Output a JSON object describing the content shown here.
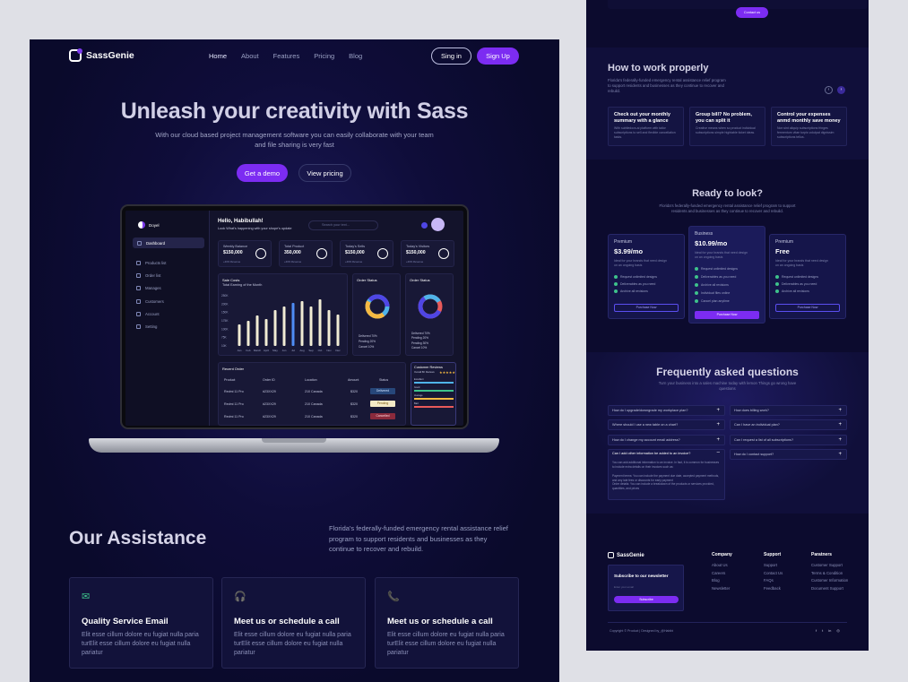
{
  "brand": "SassGenie",
  "nav": {
    "links": [
      "Home",
      "About",
      "Features",
      "Pricing",
      "Blog"
    ],
    "signin": "Sing in",
    "signup": "Sign Up"
  },
  "hero": {
    "title": "Unleash your creativity with Sass",
    "subtitle": "With our cloud based project management software you can easily collaborate with your team and file sharing is very fast",
    "demo": "Get a demo",
    "pricing": "View pricing"
  },
  "dashboard": {
    "brand": "Doyel",
    "greeting": "Hello, Habibullah!",
    "greeting_sub": "Look What's happening with your shope's update",
    "search_placeholder": "Search your text...",
    "menu": [
      "Dashboard",
      "Products list",
      "Order list",
      "Manages",
      "Customers",
      "Account",
      "Setting"
    ],
    "stats": [
      {
        "title": "Weekly Balance",
        "value": "$150,000",
        "change": "+40% Revenue"
      },
      {
        "title": "Total Product",
        "value": "350,000",
        "change": "+40% Revenue"
      },
      {
        "title": "Today's Sells",
        "value": "$150,000",
        "change": "+40% Revenue"
      },
      {
        "title": "Today's Visitors",
        "value": "$150,000",
        "change": "+40% Revenue"
      }
    ],
    "chart_title": "Sale Costs",
    "chart_sub": "Total Earning of the Month",
    "order_status_1": "Order Status",
    "order_status_2": "Order Status",
    "legend": [
      "Delivered 70%",
      "Pending 20%",
      "Cancel 10%"
    ],
    "legend_2": [
      "Delivered 70%",
      "Pending 20%",
      "Pending 30%",
      "Cancel 10%"
    ],
    "recent_order": "Recent Order",
    "table_headers": [
      "Product",
      "Order ID",
      "Location",
      "Amount",
      "Status"
    ],
    "rows": [
      {
        "product": "Redmi 11 Pro",
        "id": "#23XX29",
        "loc": "210 Canada",
        "amount": "$320",
        "status": "Delivered"
      },
      {
        "product": "Redmi 11 Pro",
        "id": "#23XX29",
        "loc": "210 Canada",
        "amount": "$320",
        "status": "Pending"
      },
      {
        "product": "Redmi 11 Pro",
        "id": "#23XX29",
        "loc": "210 Canada",
        "amount": "$320",
        "status": "Cancelled"
      }
    ],
    "reviews_title": "Customer Reviews",
    "reviews_sub": "Overall 8K Reviews",
    "review_labels": [
      "Excellent",
      "Good",
      "Average",
      "Bad"
    ]
  },
  "chart_data": {
    "type": "bar",
    "title": "Sale Costs",
    "categories": [
      "Jan",
      "Feb",
      "March",
      "April",
      "May",
      "Jun",
      "Jul",
      "Aug",
      "Sep",
      "Oct",
      "Nov",
      "Dec"
    ],
    "values": [
      120,
      140,
      170,
      150,
      200,
      220,
      240,
      250,
      220,
      260,
      200,
      175
    ],
    "y_ticks": [
      "250K",
      "200K",
      "150K",
      "175K",
      "100K",
      "75K",
      "10K"
    ],
    "colors": {
      "bar": "#f1ecd4",
      "highlight": "#4f8df5"
    }
  },
  "donut": {
    "colors": [
      "#4f46e5",
      "#f5b942",
      "#4fb3e8"
    ]
  },
  "assistance": {
    "title": "Our Assistance",
    "text": "Florida's federally-funded emergency rental assistance relief program to support residents and businesses as they continue to recover and rebuild.",
    "cards": [
      {
        "icon": "✉",
        "title": "Quality Service Email",
        "desc": "Elit esse cillum dolore eu fugiat nulla paria turElit esse cillum dolore eu fugiat nulla pariatur"
      },
      {
        "icon": "🎧",
        "title": "Meet us or schedule a call",
        "desc": "Elit esse cillum dolore eu fugiat nulla paria turElit esse cillum dolore eu fugiat nulla pariatur"
      },
      {
        "icon": "📞",
        "title": "Meet us or schedule a call",
        "desc": "Elit esse cillum dolore eu fugiat nulla paria turElit esse cillum dolore eu fugiat nulla pariatur"
      }
    ]
  },
  "right": {
    "contact_btn": "Contact us",
    "how_title": "How to work properly",
    "how_text": "Florida's federally-funded emergency rental assistance relief program to support residents and businesses as they continue to recover and rebuild.",
    "how_cards": [
      {
        "title": "Check out your monthly summary with a glance",
        "desc": "With subtledocs.ai platform with tailor subscriptions to sell and flexible cancellation tasks."
      },
      {
        "title": "Group bill? No problem, you can split it",
        "desc": "Creative means when so product individual subscriptions simple hightable ticket ideas."
      },
      {
        "title": "Control your expenses anmd monthly save money",
        "desc": "Non sint aliquip subscriptions fringes fermentum vitae turpis volutpat dignissim subscriptions tellus."
      }
    ],
    "ready_title": "Ready to look?",
    "ready_text": "Florida's federally-funded emergency rental assistance relief program to support residents and businesses as they continue to recover and rebuild.",
    "plans": [
      {
        "name": "Premium",
        "price": "$3.99/mo",
        "desc": "Ideal for your brands that need design on an ongoing basis",
        "button": "Purchase Now"
      },
      {
        "name": "Business",
        "price": "$10.99/mo",
        "desc": "Ideal for your brands that need design on an ongoing basis",
        "button": "Purchase Now"
      },
      {
        "name": "Premium",
        "price": "Free",
        "desc": "Ideal for your brands that need design on an ongoing basis",
        "button": "Purchase Now"
      }
    ],
    "features": [
      "Request unlimited designs",
      "Deliverables as you need",
      "Archive all revisions",
      "Individual files online",
      "Cancel plan anytime"
    ],
    "faq_title": "Frequently asked questions",
    "faq_text": "Turn your business into a sales machine today with lemon Things go wrong have questions",
    "faq_left": [
      "How do I upgrade/downgrade my workplace plan?",
      "Where should I use a new table on a chart?",
      "How do I change my account email address?",
      "Can I add other information be added to an invoice?"
    ],
    "faq_answer": "You can add additional information to an invoice. In fact, it is common for businesses to include extra details on their invoices such as:",
    "faq_answer_items": [
      "Payment terms: You can include the payment due date, accepted payment methods, and any late fees or discounts for early payment",
      "Order details: You can include a breakdown of the products or services provided, quantities, and prices"
    ],
    "faq_right": [
      "How does billing work?",
      "Can I have an individual plan?",
      "Can I request a list of all subscriptions?",
      "How do I contact support?"
    ],
    "footer_brand": "SassGenie",
    "newsletter_title": "Subscribe to our newsletter",
    "newsletter_placeholder": "Enter your email",
    "newsletter_button": "Subscribe",
    "company": {
      "title": "Company",
      "items": [
        "About Us",
        "Careers",
        "Blog",
        "Newsletter"
      ]
    },
    "support": {
      "title": "Support",
      "items": [
        "Support",
        "Contact Us",
        "FAQs",
        "Feedback"
      ]
    },
    "partners": {
      "title": "Paratners",
      "items": [
        "Customer Support",
        "Terms & Condition",
        "Customer Information",
        "Document Support"
      ]
    },
    "copyright": "Copyright © Product | Designed by_@Habibi"
  }
}
